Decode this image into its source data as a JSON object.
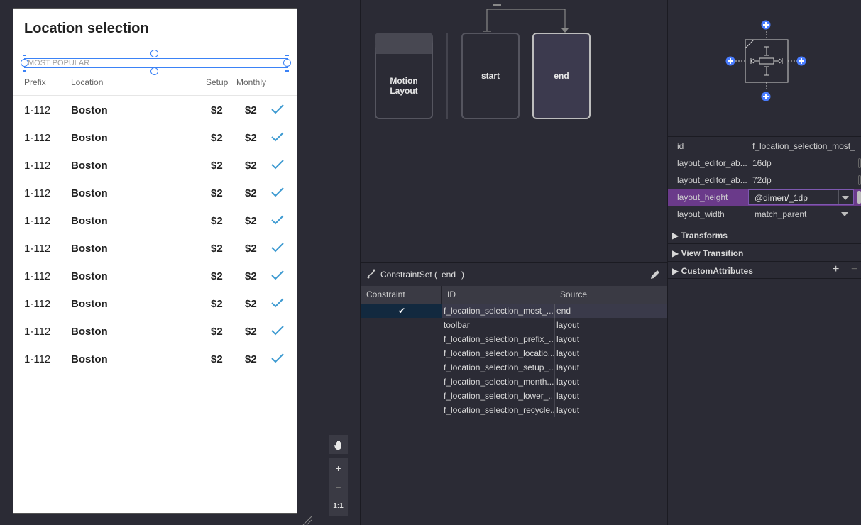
{
  "device": {
    "title": "Location selection",
    "most_popular": "MOST POPULAR",
    "headers": {
      "prefix": "Prefix",
      "location": "Location",
      "setup": "Setup",
      "monthly": "Monthly"
    },
    "rows": [
      {
        "prefix": "1-112",
        "location": "Boston",
        "setup": "$2",
        "monthly": "$2"
      },
      {
        "prefix": "1-112",
        "location": "Boston",
        "setup": "$2",
        "monthly": "$2"
      },
      {
        "prefix": "1-112",
        "location": "Boston",
        "setup": "$2",
        "monthly": "$2"
      },
      {
        "prefix": "1-112",
        "location": "Boston",
        "setup": "$2",
        "monthly": "$2"
      },
      {
        "prefix": "1-112",
        "location": "Boston",
        "setup": "$2",
        "monthly": "$2"
      },
      {
        "prefix": "1-112",
        "location": "Boston",
        "setup": "$2",
        "monthly": "$2"
      },
      {
        "prefix": "1-112",
        "location": "Boston",
        "setup": "$2",
        "monthly": "$2"
      },
      {
        "prefix": "1-112",
        "location": "Boston",
        "setup": "$2",
        "monthly": "$2"
      },
      {
        "prefix": "1-112",
        "location": "Boston",
        "setup": "$2",
        "monthly": "$2"
      },
      {
        "prefix": "1-112",
        "location": "Boston",
        "setup": "$2",
        "monthly": "$2"
      }
    ],
    "check_color": "#3d9ad1"
  },
  "zoom_tools": {
    "zoom_in": "+",
    "zoom_out": "−",
    "reset": "1:1"
  },
  "motion": {
    "cards": [
      {
        "label_line1": "Motion",
        "label_line2": "Layout"
      },
      {
        "label_line1": "start",
        "label_line2": ""
      },
      {
        "label_line1": "end",
        "label_line2": ""
      }
    ]
  },
  "constraint_set": {
    "title": "ConstraintSet (",
    "name": "end",
    "close": ")",
    "columns": {
      "constraint": "Constraint",
      "id": "ID",
      "source": "Source"
    },
    "rows": [
      {
        "constraint": "✔",
        "id": "f_location_selection_most_...",
        "source": "end"
      },
      {
        "constraint": "",
        "id": "toolbar",
        "source": "layout"
      },
      {
        "constraint": "",
        "id": "f_location_selection_prefix_...",
        "source": "layout"
      },
      {
        "constraint": "",
        "id": "f_location_selection_locatio...",
        "source": "layout"
      },
      {
        "constraint": "",
        "id": "f_location_selection_setup_...",
        "source": "layout"
      },
      {
        "constraint": "",
        "id": "f_location_selection_month...",
        "source": "layout"
      },
      {
        "constraint": "",
        "id": "f_location_selection_lower_...",
        "source": "layout"
      },
      {
        "constraint": "",
        "id": "f_location_selection_recycle...",
        "source": "layout"
      }
    ]
  },
  "properties": {
    "rows": [
      {
        "key": "id",
        "value": "f_location_selection_most_"
      },
      {
        "key": "layout_editor_ab...",
        "value": "16dp"
      },
      {
        "key": "layout_editor_ab...",
        "value": "72dp"
      },
      {
        "key": "layout_height",
        "value": "@dimen/_1dp"
      },
      {
        "key": "layout_width",
        "value": "match_parent"
      }
    ],
    "sections": [
      {
        "label": "Transforms"
      },
      {
        "label": "View Transition"
      },
      {
        "label": "CustomAttributes"
      }
    ],
    "add": "+",
    "remove": "−",
    "highlight_color": "#6a3a8a",
    "accent_color": "#4a7dff"
  }
}
